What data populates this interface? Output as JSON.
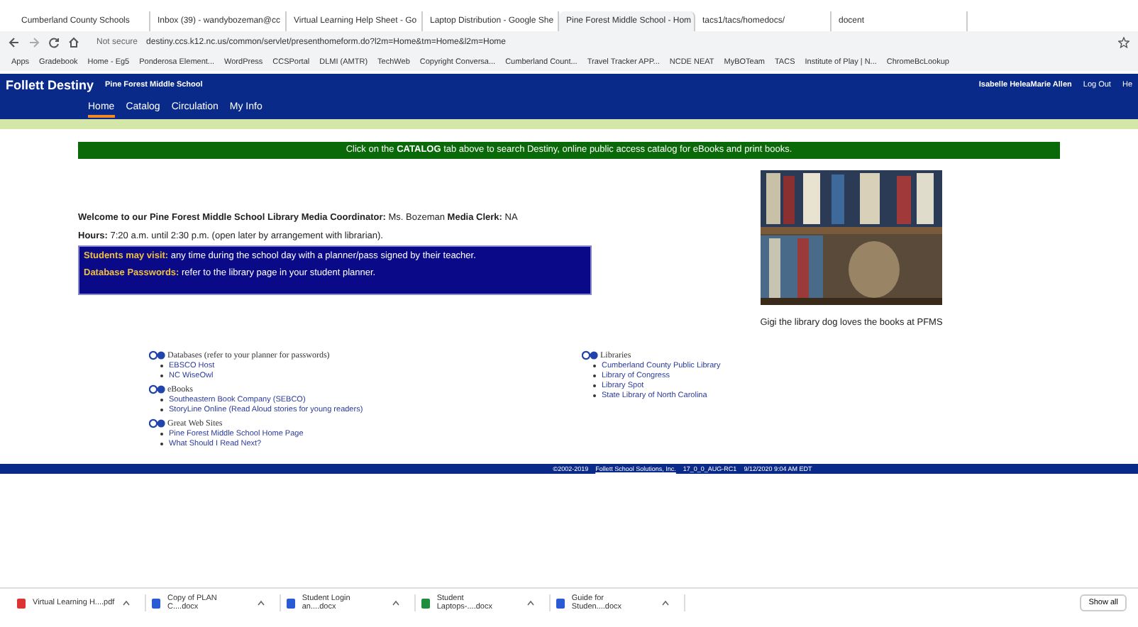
{
  "browser_tabs": [
    {
      "title": "Cumberland County Schools",
      "selected": false
    },
    {
      "title": "Inbox (39) - wandybozeman@cc",
      "selected": false
    },
    {
      "title": "Virtual Learning Help Sheet - Go",
      "selected": false
    },
    {
      "title": "Laptop Distribution - Google She",
      "selected": false
    },
    {
      "title": "Pine Forest Middle School - Hom",
      "selected": true
    },
    {
      "title": "tacs1/tacs/homedocs/",
      "selected": false
    },
    {
      "title": "docent",
      "selected": false
    }
  ],
  "address_bar": {
    "security": "Not secure",
    "url": "destiny.ccs.k12.nc.us/common/servlet/presenthomeform.do?l2m=Home&tm=Home&l2m=Home"
  },
  "bookmarks": [
    "Apps",
    "Gradebook",
    "Home - Eg5",
    "Ponderosa Element...",
    "WordPress",
    "CCSPortal",
    "DLMI (AMTR)",
    "TechWeb",
    "Copyright Conversa...",
    "Cumberland Count...",
    "Travel Tracker APP...",
    "NCDE NEAT",
    "MyBOTeam",
    "TACS",
    "Institute of Play | N...",
    "ChromeBcLookup"
  ],
  "header": {
    "brand": "Follett Destiny",
    "school": "Pine Forest Middle School",
    "user": "Isabelle HeleaMarie Allen",
    "logout": "Log Out",
    "help": "He",
    "nav": [
      {
        "label": "Home",
        "selected": true
      },
      {
        "label": "Catalog",
        "selected": false
      },
      {
        "label": "Circulation",
        "selected": false
      },
      {
        "label": "My Info",
        "selected": false
      }
    ]
  },
  "banner": "Click on the **CATALOG** tab above to search Destiny, online public access catalog for eBooks and print books.",
  "welcome": "**Welcome to our Pine Forest Middle School Library  Media Coordinator:** Ms. Bozeman **Media Clerk:** NA",
  "hours": "**Hours:**  7:20 a.m. until 2:30 p.m. (open later by arrangement with librarian).",
  "notice_lines": [
    "**Students may visit:** any time during the school day with a planner/pass signed by their teacher.",
    "**Database Passwords:**  refer to the library page in your student planner."
  ],
  "photo": {
    "kind": "picture",
    "caption": "Gigi the library dog loves the books at PFMS"
  },
  "left_sections": [
    {
      "title": "Databases (refer to your planner for passwords)",
      "links": [
        "EBSCO Host",
        "NC WiseOwl"
      ]
    },
    {
      "title": "eBooks",
      "links": [
        "Southeastern Book Company (SEBCO)",
        "StoryLine Online (Read Aloud stories for young readers)"
      ]
    },
    {
      "title": "Great Web Sites",
      "links": [
        "Pine Forest Middle School Home Page",
        "What Should I Read Next?"
      ]
    }
  ],
  "right_sections": [
    {
      "title": "Libraries",
      "links": [
        "Cumberland County Public Library",
        "Library of Congress",
        "Library Spot",
        "State Library of North Carolina"
      ]
    }
  ],
  "footer": {
    "copyright": "©2002-2019",
    "company": "Follett School Solutions, Inc.",
    "version": "17_0_0_AUG-RC1",
    "timestamp": "9/12/2020 9:04 AM EDT"
  },
  "downloads": [
    {
      "name": "Virtual Learning H....pdf",
      "kind": "pdf"
    },
    {
      "name": "Copy of PLAN C....docx",
      "kind": "doc"
    },
    {
      "name": "Student Login an....docx",
      "kind": "doc"
    },
    {
      "name": "Student Laptops-....docx",
      "kind": "sheet"
    },
    {
      "name": "Guide for Studen....docx",
      "kind": "doc"
    }
  ],
  "show_all": "Show all"
}
